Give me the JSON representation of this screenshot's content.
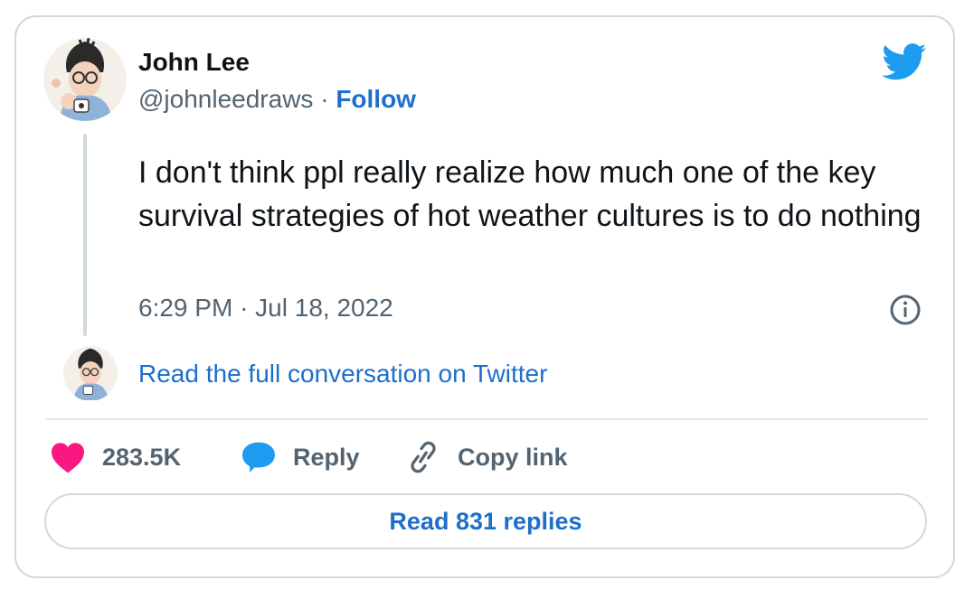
{
  "author": {
    "name": "John Lee",
    "handle": "@johnleedraws",
    "separator": "·",
    "follow_label": "Follow"
  },
  "tweet": {
    "text": "I don't think ppl really realize how much one of the key survival strategies of hot weather cultures is to do nothing",
    "time": "6:29 PM",
    "date": "Jul 18, 2022",
    "meta_separator": "·"
  },
  "conversation": {
    "read_full_label": "Read the full conversation on Twitter"
  },
  "actions": {
    "like_count": "283.5K",
    "reply_label": "Reply",
    "copy_link_label": "Copy link"
  },
  "replies": {
    "button_label": "Read 831 replies"
  },
  "icons": {
    "brand": "twitter-bird-icon",
    "info": "info-icon",
    "like": "heart-icon",
    "reply": "speech-bubble-icon",
    "copy": "link-icon"
  },
  "colors": {
    "link_blue": "#1d6fcb",
    "twitter_blue": "#1d9bf0",
    "heart_pink": "#f91880",
    "muted_text": "#536471",
    "border": "#cfd9de"
  }
}
